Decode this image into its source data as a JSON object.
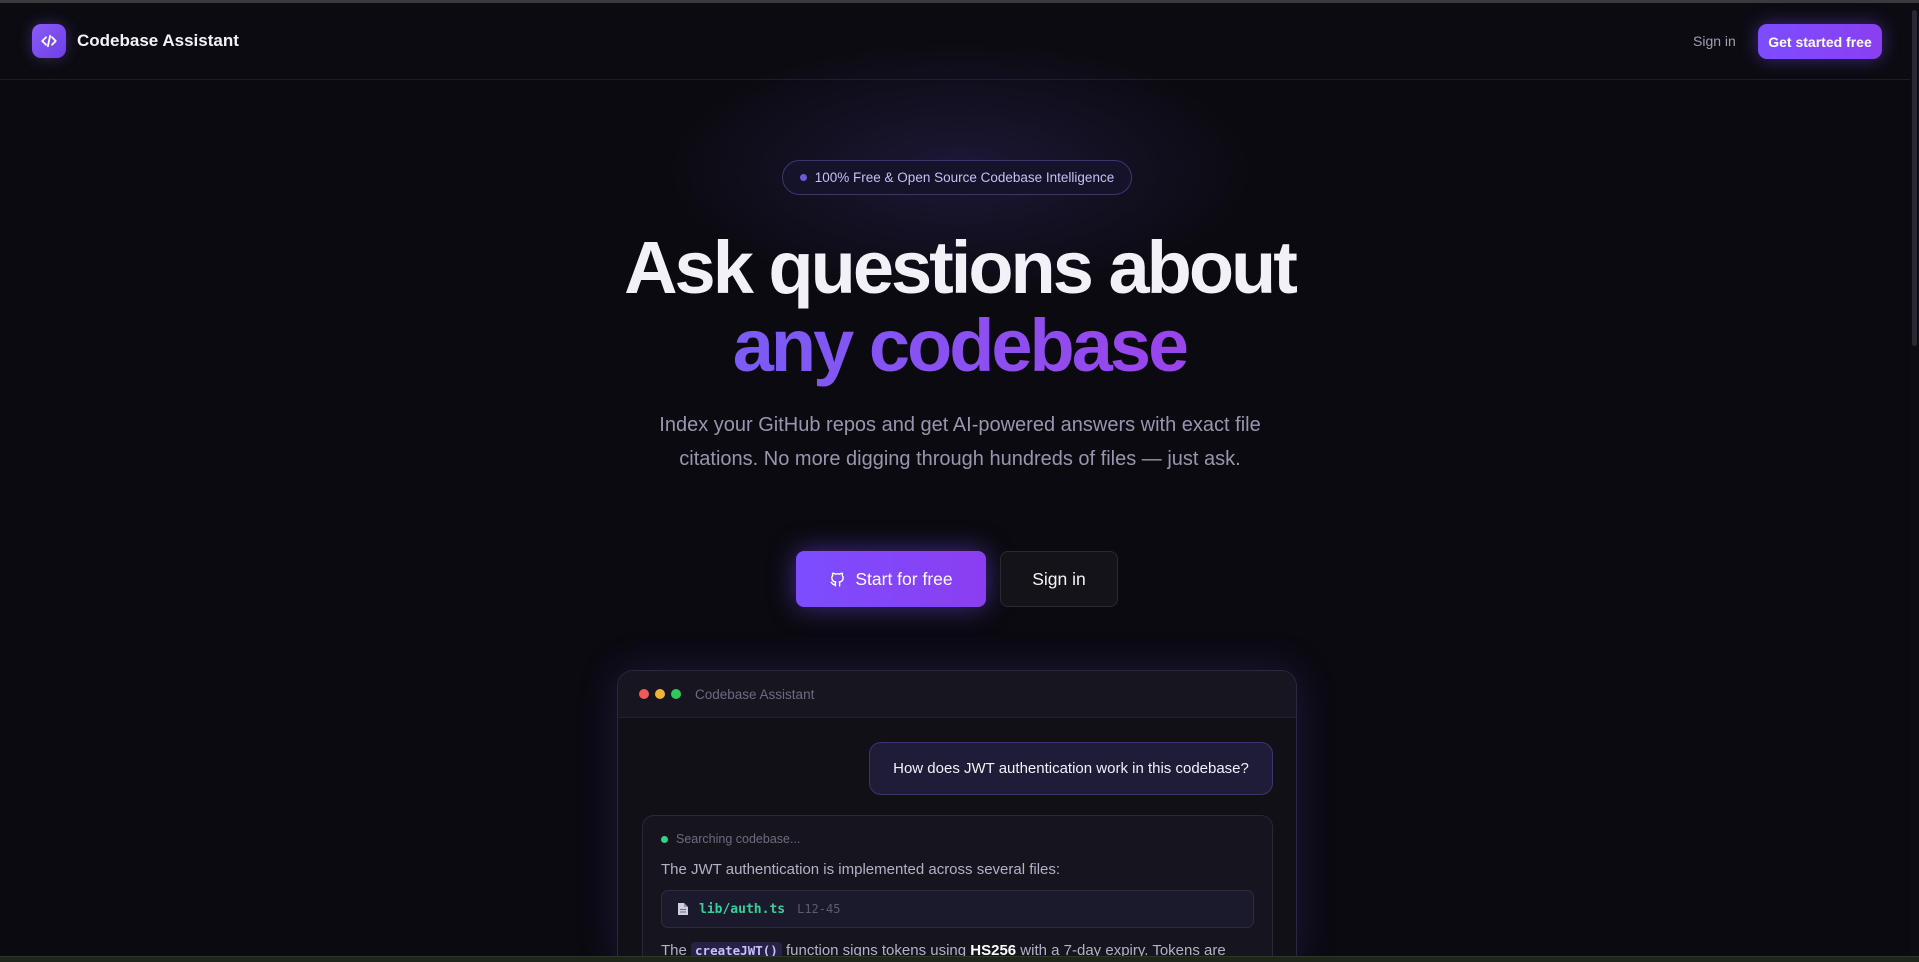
{
  "nav": {
    "brand": "Codebase Assistant",
    "sign_in": "Sign in",
    "cta": "Get started free"
  },
  "hero": {
    "badge": "100% Free & Open Source Codebase Intelligence",
    "title_line1": "Ask questions about",
    "title_line2": "any codebase",
    "subtitle": "Index your GitHub repos and get AI-powered answers with exact file citations. No more digging through hundreds of files — just ask.",
    "primary_button": "Start for free",
    "secondary_button": "Sign in"
  },
  "preview": {
    "window_title": "Codebase Assistant",
    "user_question": "How does JWT authentication work in this codebase?",
    "status": "Searching codebase...",
    "intro": "The JWT authentication is implemented across several files:",
    "file": "lib/auth.ts",
    "lines": "L12-45",
    "body_pre": "The ",
    "code": "createJWT()",
    "body_mid": " function signs tokens using ",
    "algo": "HS256",
    "body_post": " with a 7-day expiry. Tokens are"
  },
  "colors": {
    "accent": "#7c4dff",
    "accent_end": "#8b3ef0",
    "background": "#0b0a10",
    "status_green": "#2fd38a"
  },
  "icons": {
    "logo": "code-icon",
    "primary_button": "github-icon",
    "file": "file-icon"
  }
}
